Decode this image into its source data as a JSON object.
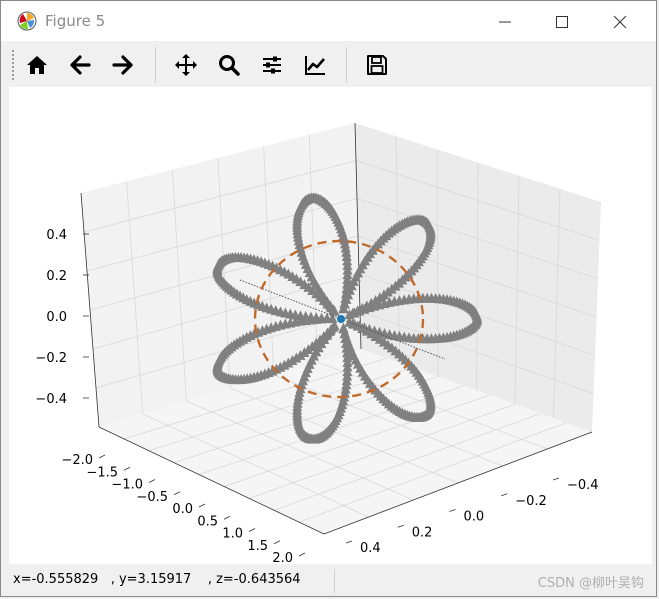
{
  "window": {
    "title": "Figure 5"
  },
  "toolbar": {
    "buttons": [
      {
        "icon": "home-icon"
      },
      {
        "icon": "back-arrow-icon"
      },
      {
        "icon": "forward-arrow-icon"
      },
      {
        "icon": "pan-icon"
      },
      {
        "icon": "zoom-icon"
      },
      {
        "icon": "subplots-config-icon"
      },
      {
        "icon": "edit-axes-icon"
      },
      {
        "icon": "save-icon"
      }
    ]
  },
  "plot": {
    "z_ticks": [
      "0.4",
      "0.2",
      "0.0",
      "−0.2",
      "−0.4"
    ],
    "x_ticks": [
      "−2.0",
      "−1.5",
      "−1.0",
      "−0.5",
      "0.0",
      "0.5",
      "1.0",
      "1.5",
      "2.0"
    ],
    "y_ticks": [
      "−0.4",
      "−0.2",
      "0.0",
      "0.2",
      "0.4"
    ],
    "colors": {
      "flower": "#808080",
      "circle": "#c06a2b",
      "center": "#1f77b4",
      "pane": "#f2f2f2",
      "grid": "#d8d8d8"
    }
  },
  "status": {
    "coords": "x=-0.555829   , y=3.15917    , z=-0.643564",
    "watermark": "CSDN @柳叶吴钩"
  }
}
